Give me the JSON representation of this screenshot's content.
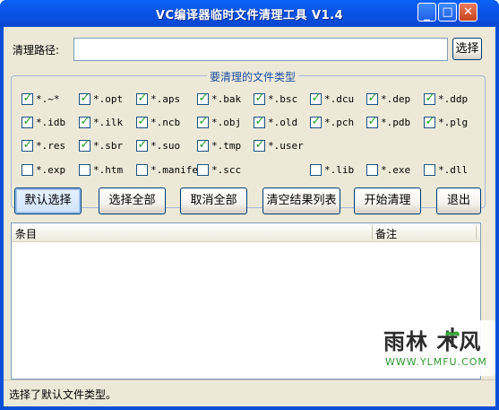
{
  "window": {
    "title": "VC编译器临时文件清理工具 V1.4",
    "min_glyph": "_",
    "max_glyph": "□",
    "close_glyph": "✕"
  },
  "path": {
    "label": "清理路径:",
    "value": "",
    "browse_label": "选择"
  },
  "filetypes": {
    "legend": "要清理的文件类型",
    "items": [
      {
        "label": "*.~*",
        "checked": true
      },
      {
        "label": "*.opt",
        "checked": true
      },
      {
        "label": "*.aps",
        "checked": true
      },
      {
        "label": "*.bak",
        "checked": true
      },
      {
        "label": "*.bsc",
        "checked": true
      },
      {
        "label": "*.dcu",
        "checked": true
      },
      {
        "label": "*.dep",
        "checked": true
      },
      {
        "label": "*.ddp",
        "checked": true
      },
      {
        "label": "*.idb",
        "checked": true
      },
      {
        "label": "*.ilk",
        "checked": true
      },
      {
        "label": "*.ncb",
        "checked": true
      },
      {
        "label": "*.obj",
        "checked": true
      },
      {
        "label": "*.old",
        "checked": true
      },
      {
        "label": "*.pch",
        "checked": true
      },
      {
        "label": "*.pdb",
        "checked": true
      },
      {
        "label": "*.plg",
        "checked": true
      },
      {
        "label": "*.res",
        "checked": true
      },
      {
        "label": "*.sbr",
        "checked": true
      },
      {
        "label": "*.suo",
        "checked": true
      },
      {
        "label": "*.tmp",
        "checked": true
      },
      {
        "label": "*.user",
        "checked": true
      },
      {
        "label": "*.exp",
        "checked": false
      },
      {
        "label": "*.htm",
        "checked": false
      },
      {
        "label": "*.manifest",
        "checked": false
      },
      {
        "label": "*.scc",
        "checked": false
      },
      {
        "label": "*.lib",
        "checked": false
      },
      {
        "label": "*.exe",
        "checked": false
      },
      {
        "label": "*.dll",
        "checked": false
      }
    ],
    "check_glyph": "✓"
  },
  "actions": {
    "default_select": "默认选择",
    "select_all": "选择全部",
    "deselect_all": "取消全部",
    "clear_results": "清空结果列表",
    "start_clean": "开始清理",
    "exit": "退出"
  },
  "results": {
    "columns": [
      "条目",
      "备注"
    ],
    "rows": []
  },
  "status": {
    "text": "选择了默认文件类型。"
  },
  "watermark": {
    "main": "雨林 木风",
    "sub": "WWW.YLMFU.COM"
  },
  "colors": {
    "titlebar": "#0a55e8",
    "check": "#21a121",
    "group_legend": "#1b4ea3"
  }
}
